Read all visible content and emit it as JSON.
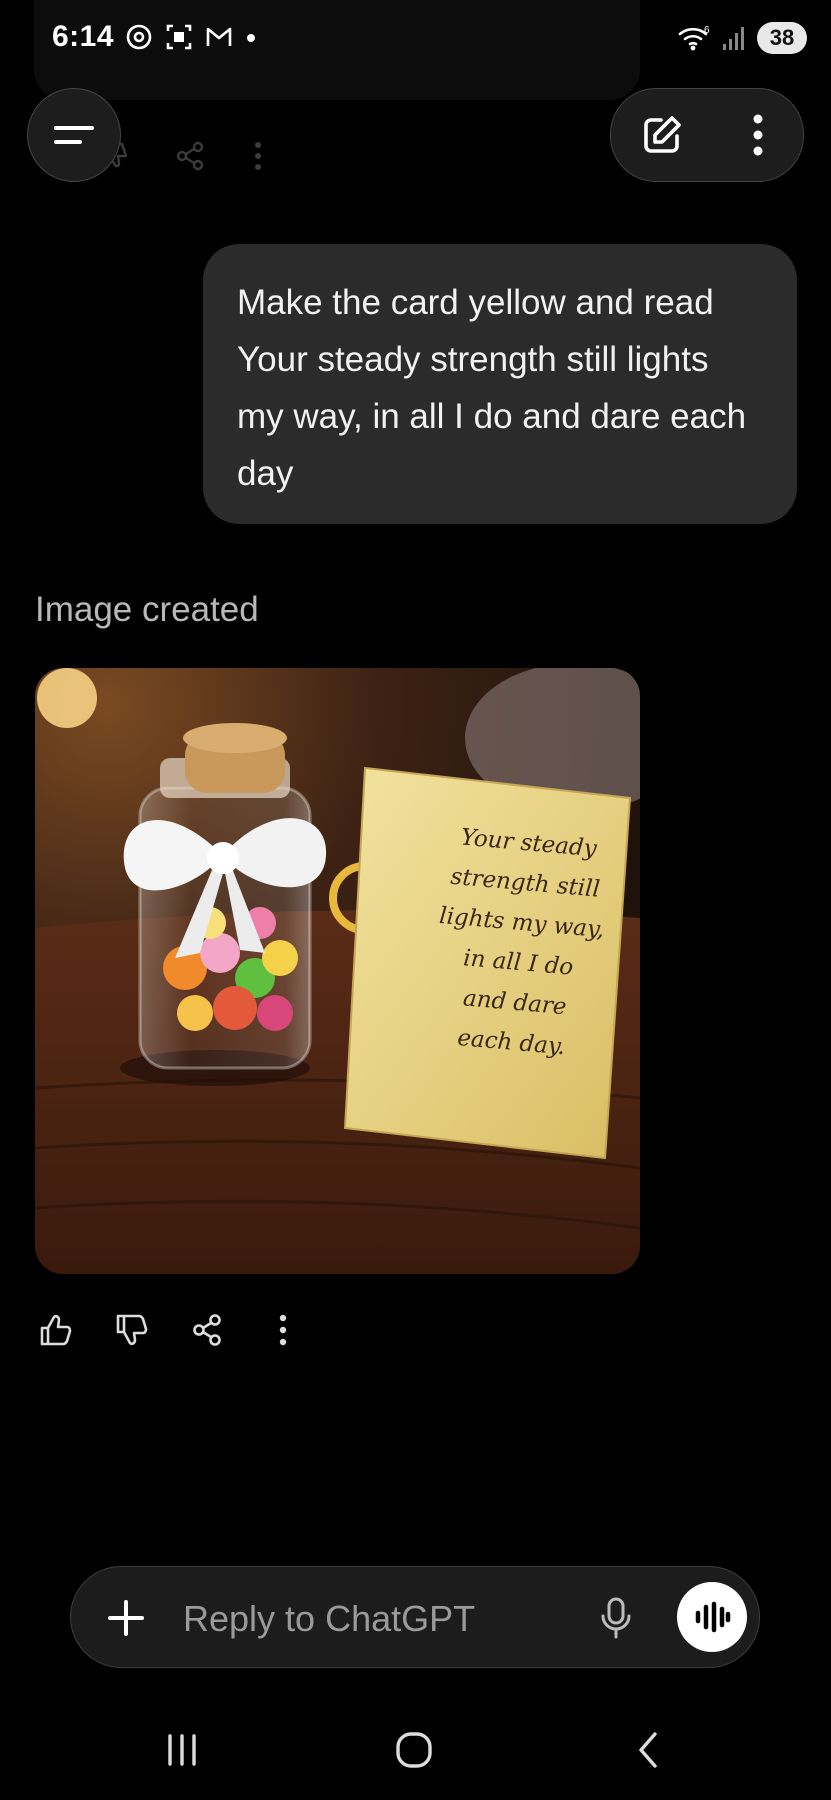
{
  "status_bar": {
    "time": "6:14",
    "battery": "38",
    "network_label": "6"
  },
  "conversation": {
    "user_message": "Make the card yellow and read Your steady strength still lights my way, in all I do and dare each day",
    "image_created_label": "Image created",
    "image": {
      "card_lines": [
        "Your steady",
        "strength still",
        "lights my way,",
        "in all I do",
        "and dare",
        "each day."
      ],
      "card_color": "#ecd78a",
      "table_color": "#4a2414"
    }
  },
  "composer": {
    "placeholder": "Reply to ChatGPT"
  },
  "colors": {
    "background": "#000000",
    "bubble": "#2b2b2b",
    "muted_text": "#b8b8b8"
  },
  "icons": [
    "menu-icon",
    "edit-icon",
    "more-icon",
    "thumbs-up-icon",
    "thumbs-down-icon",
    "share-icon",
    "plus-icon",
    "mic-icon",
    "voice-mode-icon",
    "recents-icon",
    "home-icon",
    "back-icon"
  ]
}
